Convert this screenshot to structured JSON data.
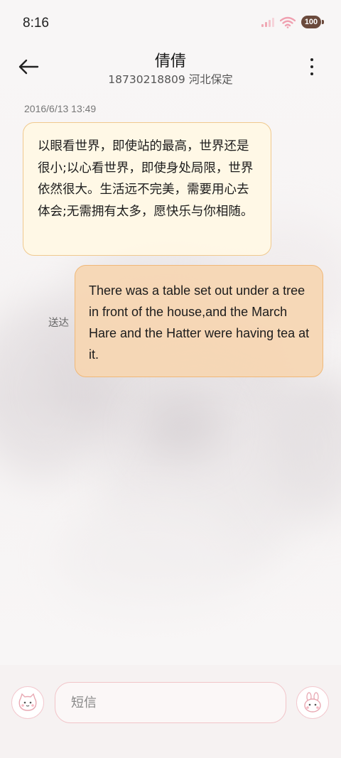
{
  "status_bar": {
    "time": "8:16",
    "battery": "100"
  },
  "header": {
    "contact_name": "倩倩",
    "contact_number": "18730218809",
    "contact_location": "河北保定"
  },
  "conversation": {
    "timestamp": "2016/6/13 13:49",
    "messages": [
      {
        "direction": "incoming",
        "text": "以眼看世界，即使站的最高，世界还是很小;以心看世界，即使身处局限，世界依然很大。生活远不完美，需要用心去体会;无需拥有太多，愿快乐与你相随。"
      },
      {
        "direction": "outgoing",
        "text": "There was a table set out under a tree in front of the house,and the March Hare and the Hatter were having tea at it.",
        "status": "送达"
      }
    ]
  },
  "composer": {
    "placeholder": "短信"
  },
  "colors": {
    "incoming_bubble": "#fff8e5",
    "incoming_border": "#f0c98e",
    "outgoing_bubble": "#f6d6b2",
    "outgoing_border": "#f0b878",
    "input_border": "#f1c4c8"
  },
  "icons": {
    "back": "arrow-left-icon",
    "more": "more-vertical-icon",
    "signal": "signal-icon",
    "wifi": "wifi-icon",
    "battery": "battery-icon",
    "sticker_left": "cat-sticker-icon",
    "sticker_right": "bunny-sticker-icon"
  }
}
